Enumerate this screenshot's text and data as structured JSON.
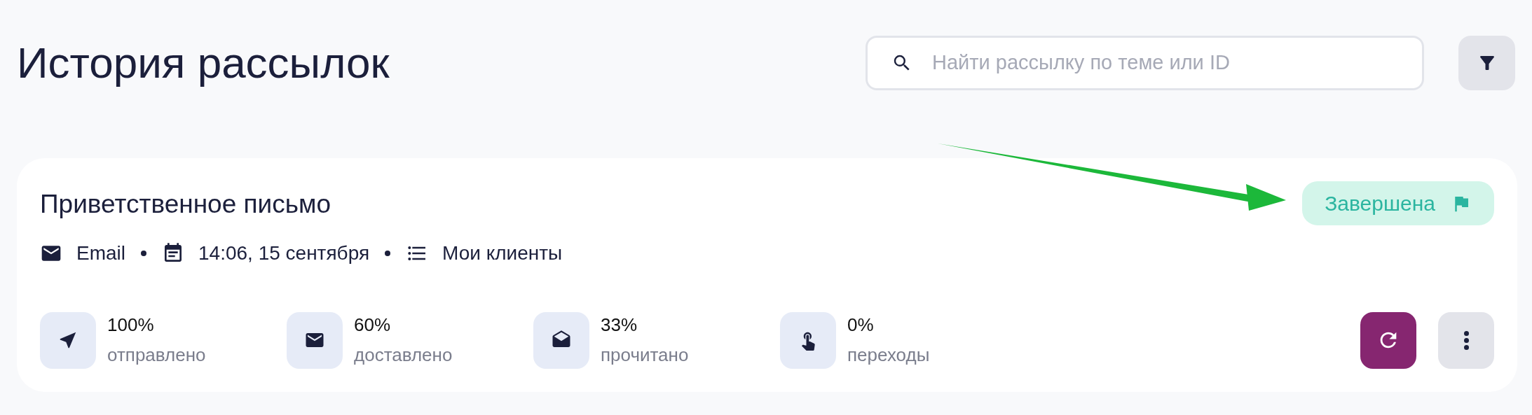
{
  "page": {
    "title": "История рассылок"
  },
  "search": {
    "placeholder": "Найти рассылку по теме или ID"
  },
  "campaign": {
    "title": "Приветственное письмо",
    "status": {
      "label": "Завершена",
      "kind": "completed"
    },
    "meta": [
      {
        "kind": "channel",
        "text": "Email"
      },
      {
        "kind": "date",
        "text": "14:06, 15 сентября"
      },
      {
        "kind": "audience",
        "text": "Мои клиенты"
      }
    ],
    "stats": [
      {
        "kind": "sent",
        "value": "100%",
        "label": "отправлено"
      },
      {
        "kind": "delivered",
        "value": "60%",
        "label": "доставлено"
      },
      {
        "kind": "read",
        "value": "33%",
        "label": "прочитано"
      },
      {
        "kind": "clicks",
        "value": "0%",
        "label": "переходы"
      }
    ]
  }
}
